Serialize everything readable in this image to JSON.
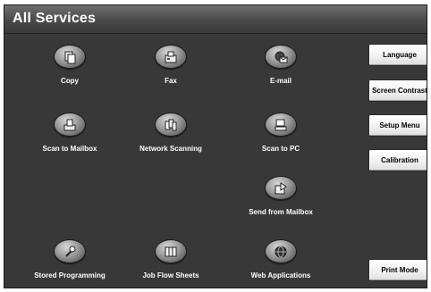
{
  "header": {
    "title": "All Services"
  },
  "services": [
    {
      "label": "Copy",
      "icon": "copy-icon"
    },
    {
      "label": "Fax",
      "icon": "fax-icon"
    },
    {
      "label": "E-mail",
      "icon": "email-icon"
    },
    {
      "label": "Scan to Mailbox",
      "icon": "scan-to-mailbox-icon"
    },
    {
      "label": "Network Scanning",
      "icon": "network-scanning-icon"
    },
    {
      "label": "Scan to PC",
      "icon": "scan-to-pc-icon"
    },
    {
      "label": "Send from Mailbox",
      "icon": "send-from-mailbox-icon"
    },
    {
      "label": "Stored Programming",
      "icon": "stored-programming-icon"
    },
    {
      "label": "Job Flow Sheets",
      "icon": "job-flow-sheets-icon"
    },
    {
      "label": "Web Applications",
      "icon": "web-applications-icon"
    }
  ],
  "side_buttons": {
    "language": "Language",
    "screen_contrast": "Screen Contrast",
    "setup_menu": "Setup Menu",
    "calibration": "Calibration",
    "print_mode": "Print Mode"
  },
  "colors": {
    "panel_background": "#383838",
    "title_text": "#ffffff",
    "button_face": "#f0f0f0"
  }
}
